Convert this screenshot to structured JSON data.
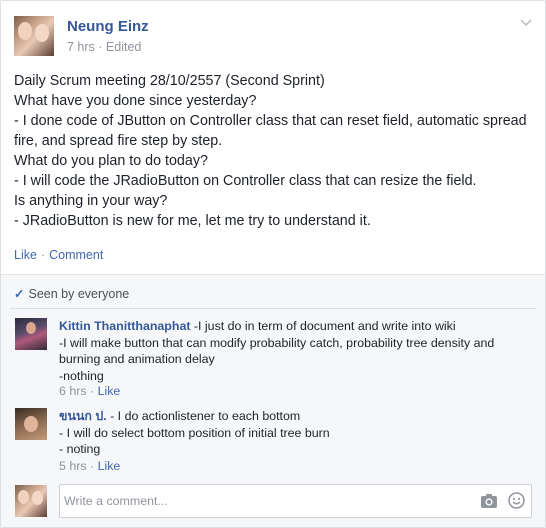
{
  "post": {
    "author": "Neung Einz",
    "time": "7 hrs",
    "meta_sep": " · ",
    "edited": "Edited",
    "text": "Daily Scrum meeting 28/10/2557 (Second Sprint)\nWhat have you done since yesterday?\n- I done code of JButton on Controller class that can reset field, automatic spread fire, and spread fire step by step.\nWhat do you plan to do today?\n- I will code the JRadioButton on Controller class that can resize the field.\nIs anything in your way?\n- JRadioButton is new for me, let me try to understand it.",
    "like_label": "Like",
    "separator": "·",
    "comment_label": "Comment"
  },
  "feedback": {
    "check": "✓",
    "seen_label": "Seen by everyone"
  },
  "comments": [
    {
      "author": "Kittin Thanitthanaphat",
      "text": " -I just do in term of document and write into wiki\n-I will make button that can modify probability catch, probability tree density and burning and animation delay\n-nothing",
      "time": "6 hrs",
      "like_label": "Like"
    },
    {
      "author": "ขนนก ป.",
      "text": " - I do actionlistener to each bottom\n- I will do select bottom position of initial tree burn\n- noting",
      "time": "5 hrs",
      "like_label": "Like"
    }
  ],
  "composer": {
    "placeholder": "Write a comment..."
  },
  "icons": {
    "chevron": "chevron-down-icon",
    "camera": "camera-icon",
    "emoji": "smiley-icon"
  },
  "colors": {
    "link": "#365899",
    "accent": "#4267b2",
    "muted": "#90949c",
    "feedback_bg": "#f6f7f9"
  }
}
